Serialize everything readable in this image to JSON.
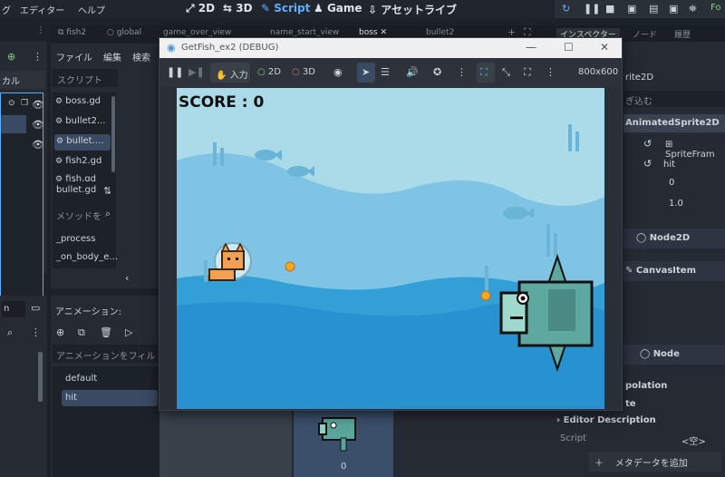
{
  "menubar": {
    "items": [
      "グ",
      "エディター",
      "ヘルプ"
    ],
    "workspaces": [
      "2D",
      "3D",
      "Script",
      "Game",
      "アセットライブ"
    ],
    "active_workspace": "Script",
    "right_label": "Fo"
  },
  "scene_tabs": [
    "fish2",
    "global",
    "game_over_view",
    "name_start_view",
    "boss",
    "bullet2"
  ],
  "inspector_tabs": [
    "インスペクター",
    "ノード",
    "履歴"
  ],
  "left_panel": {
    "label": "カル",
    "name_field": "n"
  },
  "script_panel": {
    "menu": [
      "ファイル",
      "編集",
      "検索"
    ],
    "filter_placeholder": "スクリプト",
    "scripts": [
      "boss.gd",
      "bullet2...",
      "bullet....",
      "fish2.gd",
      "fish.gd"
    ],
    "current_file": "bullet.gd",
    "method_filter_placeholder": "メソッドを",
    "methods": [
      "_process",
      "_on_body_e..."
    ]
  },
  "animation_panel": {
    "title": "アニメーション:",
    "filter_placeholder": "アニメーションをフィル",
    "animations": [
      "default",
      "hit"
    ],
    "selected": "hit",
    "frame_index": "0"
  },
  "game_window": {
    "title": "GetFish_ex2 (DEBUG)",
    "input_label": "入力",
    "mode_2d": "2D",
    "mode_3d": "3D",
    "resolution": "800x600",
    "score_text": "SCORE : 0"
  },
  "inspector": {
    "node_name": "rite2D",
    "filter_placeholder": "ぎ込む",
    "section_title": "AnimatedSprite2D",
    "sprite_frames": "SpriteFram",
    "animation_value": "hit",
    "frame_value": "0",
    "speed_value": "1.0",
    "node2d": "Node2D",
    "canvas_item": "CanvasItem",
    "node": "Node",
    "interpolation": "polation",
    "te_label": "te",
    "editor_description": "Editor Description",
    "script_label": "Script",
    "script_value": "<空>",
    "add_metadata": "メタデータを追加"
  }
}
